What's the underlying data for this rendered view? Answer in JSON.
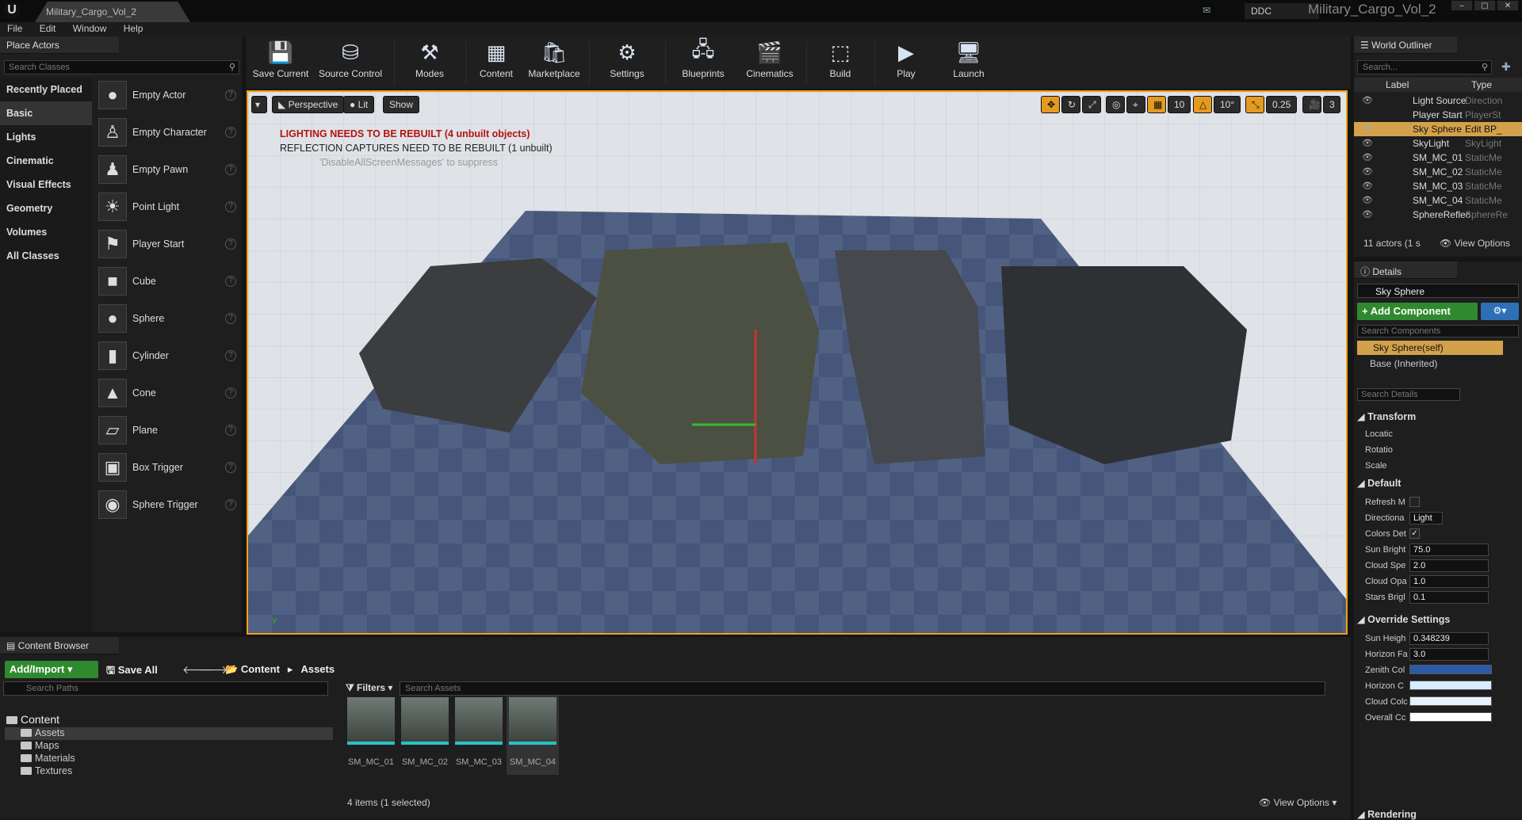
{
  "window": {
    "tab": "Military_Cargo_Vol_2",
    "ddc": "DDC",
    "project": "Military_Cargo_Vol_2"
  },
  "menu": [
    "File",
    "Edit",
    "Window",
    "Help"
  ],
  "place_actors": {
    "tab": "Place Actors",
    "search_placeholder": "Search Classes",
    "categories": [
      "Recently Placed",
      "Basic",
      "Lights",
      "Cinematic",
      "Visual Effects",
      "Geometry",
      "Volumes",
      "All Classes"
    ],
    "selected_category": "Basic",
    "actors": [
      "Empty Actor",
      "Empty Character",
      "Empty Pawn",
      "Point Light",
      "Player Start",
      "Cube",
      "Sphere",
      "Cylinder",
      "Cone",
      "Plane",
      "Box Trigger",
      "Sphere Trigger"
    ]
  },
  "toolbar": [
    "Save Current",
    "Source Control",
    "Modes",
    "Content",
    "Marketplace",
    "Settings",
    "Blueprints",
    "Cinematics",
    "Build",
    "Play",
    "Launch"
  ],
  "viewport": {
    "perspective": "Perspective",
    "lit": "Lit",
    "show": "Show",
    "grid_snap": "10",
    "rot_snap": "10°",
    "scale_snap": "0.25",
    "cam_speed": "3",
    "msg_lighting": "LIGHTING NEEDS TO BE REBUILT (4 unbuilt objects)",
    "msg_reflection": "REFLECTION CAPTURES NEED TO BE REBUILT (1 unbuilt)",
    "msg_suppress": "'DisableAllScreenMessages' to suppress"
  },
  "outliner": {
    "tab": "World Outliner",
    "search_placeholder": "Search...",
    "col_label": "Label",
    "col_type": "Type",
    "rows": [
      {
        "label": "Light Source",
        "type": "Direction"
      },
      {
        "label": "Player Start",
        "type": "PlayerSt"
      },
      {
        "label": "Sky Sphere",
        "type": "Edit BP_"
      },
      {
        "label": "SkyLight",
        "type": "SkyLight"
      },
      {
        "label": "SM_MC_01",
        "type": "StaticMe"
      },
      {
        "label": "SM_MC_02",
        "type": "StaticMe"
      },
      {
        "label": "SM_MC_03",
        "type": "StaticMe"
      },
      {
        "label": "SM_MC_04",
        "type": "StaticMe"
      },
      {
        "label": "SphereReflec",
        "type": "SphereRe"
      }
    ],
    "footer": "11 actors (1 s",
    "view_options": "View Options"
  },
  "details": {
    "tab": "Details",
    "name": "Sky Sphere",
    "add_component": "+ Add Component",
    "search_components": "Search Components",
    "self": "Sky Sphere(self)",
    "base": "Base (Inherited)",
    "search_details": "Search Details",
    "transform": "Transform",
    "location": "Locatic",
    "rotation": "Rotatio",
    "scale": "Scale",
    "default": "Default",
    "props": [
      {
        "k": "Refresh M",
        "v": ""
      },
      {
        "k": "Directiona",
        "v": "Light"
      },
      {
        "k": "Colors Det",
        "v": ""
      },
      {
        "k": "Sun Bright",
        "v": "75.0"
      },
      {
        "k": "Cloud Spe",
        "v": "2.0"
      },
      {
        "k": "Cloud Opa",
        "v": "1.0"
      },
      {
        "k": "Stars Brigl",
        "v": "0.1"
      }
    ],
    "override": "Override Settings",
    "override_props": [
      {
        "k": "Sun Heigh",
        "v": "0.348239"
      },
      {
        "k": "Horizon Fa",
        "v": "3.0"
      }
    ],
    "colors": [
      {
        "k": "Zenith Col",
        "color": "#2b5ba8"
      },
      {
        "k": "Horizon C",
        "color": "#d8ecff"
      },
      {
        "k": "Cloud Colc",
        "color": "#e6f0ff"
      },
      {
        "k": "Overall Cc",
        "color": "#ffffff"
      }
    ],
    "rendering": "Rendering"
  },
  "content_browser": {
    "tab": "Content Browser",
    "add_import": "Add/Import",
    "save_all": "Save All",
    "path_root": "Content",
    "path_current": "Assets",
    "search_paths": "Search Paths",
    "filters": "Filters",
    "search_assets": "Search Assets",
    "tree_root": "Content",
    "folders": [
      "Assets",
      "Maps",
      "Materials",
      "Textures"
    ],
    "assets": [
      "SM_MC_01",
      "SM_MC_02",
      "SM_MC_03",
      "SM_MC_04"
    ],
    "selected_asset": "SM_MC_04",
    "count": "4 items (1 selected)",
    "view_options": "View Options"
  }
}
